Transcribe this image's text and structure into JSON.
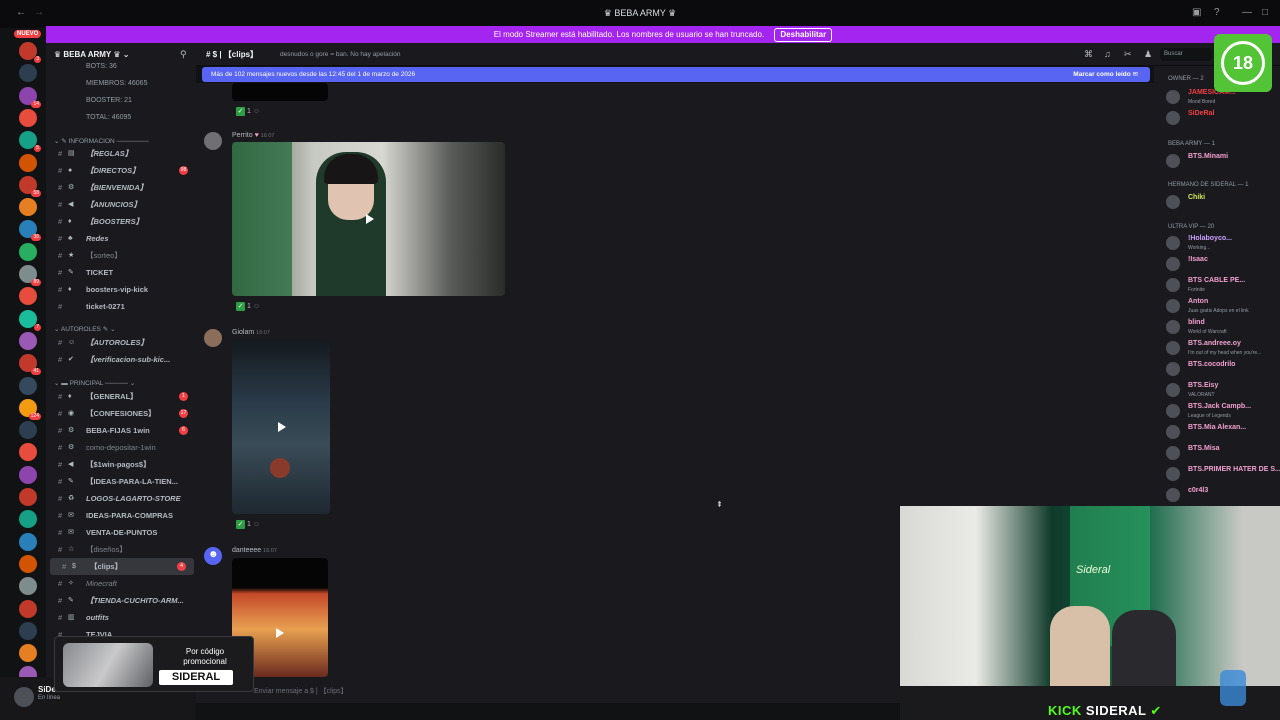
{
  "window": {
    "title": "BEBA ARMY"
  },
  "banner": {
    "text": "El modo Streamer está habilitado. Los nombres de usuario se han truncado.",
    "button": "Deshabilitar"
  },
  "servers": {
    "nuevo_label": "NUEVO",
    "badges": [
      "3",
      "9",
      "14",
      "417",
      "5",
      "260",
      "58",
      "1",
      "36",
      "3",
      "89",
      "10",
      "7",
      "147",
      "41",
      "21",
      "124"
    ]
  },
  "guild": {
    "name": "BEBA ARMY"
  },
  "stats": {
    "bots": "BOTS: 36",
    "members": "MIEMBROS: 46065",
    "boosters": "BOOSTER: 21",
    "total": "TOTAL: 46095"
  },
  "categories": {
    "info": "INFORMACION",
    "autoroles": "AUTOROLES",
    "principal": "PRINCIPAL"
  },
  "channels": [
    {
      "name": "【REGLAS】",
      "emoji": "▤",
      "style": "it"
    },
    {
      "name": "【DIRECTOS】",
      "emoji": "●",
      "style": "it",
      "badge": "98"
    },
    {
      "name": "【BIENVENIDA】",
      "emoji": "⚙",
      "style": "it"
    },
    {
      "name": "【ANUNCIOS】",
      "emoji": "◀",
      "style": "it"
    },
    {
      "name": "【BOOSTERS】",
      "emoji": "♦",
      "style": "it"
    },
    {
      "name": "Redes",
      "emoji": "♣",
      "style": "it"
    },
    {
      "name": "【sorteo】",
      "emoji": "★",
      "style": "dim"
    },
    {
      "name": "TICKET",
      "emoji": "✎",
      "style": ""
    },
    {
      "name": "boosters-vip-kick",
      "emoji": "♦",
      "style": ""
    },
    {
      "name": "ticket-0271",
      "emoji": "",
      "style": ""
    },
    {
      "name": "【AUTOROLES】",
      "emoji": "☺",
      "style": "it"
    },
    {
      "name": "【verificacion-sub-kic...",
      "emoji": "✔",
      "style": "it"
    },
    {
      "name": "【GENERAL】",
      "emoji": "♦",
      "style": "",
      "badge": "1"
    },
    {
      "name": "【CONFESIONES】",
      "emoji": "◉",
      "style": "",
      "badge": "17"
    },
    {
      "name": "BEBA-FIJAS 1win",
      "emoji": "⚙",
      "style": "",
      "badge": "6"
    },
    {
      "name": "como-depositar-1win",
      "emoji": "⚙",
      "style": "dim"
    },
    {
      "name": "【$1win-pagos$】",
      "emoji": "◀",
      "style": ""
    },
    {
      "name": "【IDEAS-PARA-LA-TIEN...",
      "emoji": "✎",
      "style": ""
    },
    {
      "name": "LOGOS-LAGARTO-STORE",
      "emoji": "♻",
      "style": "it"
    },
    {
      "name": "IDEAS-PARA-COMPRAS",
      "emoji": "✉",
      "style": ""
    },
    {
      "name": "VENTA-DE-PUNTOS",
      "emoji": "✉",
      "style": ""
    },
    {
      "name": "【diseños】",
      "emoji": "☆",
      "style": "dim"
    },
    {
      "name": "【clips】",
      "emoji": "$",
      "style": "",
      "badge": "4"
    },
    {
      "name": "Minecraft",
      "emoji": "✧",
      "style": "dim it"
    },
    {
      "name": "【TIENDA-CUCHITO-ARM...",
      "emoji": "✎",
      "style": "it"
    },
    {
      "name": "outfits",
      "emoji": "▥",
      "style": "it"
    },
    {
      "name": "TEJVIA",
      "emoji": "",
      "style": ""
    }
  ],
  "header": {
    "channel": "$ | 【clips】",
    "topic": "desnudos o gore = ban. No hay apelación",
    "search": "Buscar"
  },
  "newbar": {
    "text": "Más de 102 mensajes nuevos desde las 12:45 del 1 de marzo de 2026",
    "mark": "Marcar como leído"
  },
  "messages": [
    {
      "user": "Perrito",
      "time": "16:07",
      "count": "1"
    },
    {
      "user": "Giolam",
      "time": "16:07",
      "count": "1"
    },
    {
      "user": "danteeee",
      "time": "16:07",
      "count": "1"
    }
  ],
  "first_reaction": {
    "count": "1"
  },
  "composer": {
    "placeholder": "Enviar mensaje a $ | 【clips】"
  },
  "members": {
    "groups": {
      "owner": "OWNER — 2",
      "beba": "BEBA ARMY — 1",
      "hermano": "hermano de sideral — 1",
      "ultra": "ULTRA VIP — 20"
    },
    "list": [
      {
        "name": "JAMESICAM...",
        "status": "Mood Bored",
        "color": "#f23f43"
      },
      {
        "name": "SiDeRal",
        "status": "",
        "color": "#f23f43"
      },
      {
        "name": "BTS.Minami",
        "status": "",
        "color": "#f2a0d0"
      },
      {
        "name": "Chiki",
        "status": "",
        "color": "#d4e85b"
      },
      {
        "name": "!Holaboyco...",
        "status": "Working...",
        "color": "#c9a0ff"
      },
      {
        "name": "!Isaac",
        "status": "",
        "color": "#f2a0d0"
      },
      {
        "name": "BTS CABLE PE...",
        "status": "Fortnite",
        "color": "#f2a0d0"
      },
      {
        "name": "Anton",
        "status": "Juas gratis Adops en el link",
        "color": "#f2a0d0"
      },
      {
        "name": "blind",
        "status": "World of Warcraft",
        "color": "#f2a0d0"
      },
      {
        "name": "BTS.andreee.oy",
        "status": "I'm out of my head when you're...",
        "color": "#f2a0d0"
      },
      {
        "name": "BTS.cocodrilo",
        "status": "",
        "color": "#f2a0d0"
      },
      {
        "name": "BTS.Eisy",
        "status": "VALORANT",
        "color": "#f2a0d0"
      },
      {
        "name": "BTS.Jack Campb...",
        "status": "League of Legends",
        "color": "#f2a0d0"
      },
      {
        "name": "BTS.Mia Alexan...",
        "status": "",
        "color": "#f2a0d0"
      },
      {
        "name": "BTS.Misa",
        "status": "",
        "color": "#f2a0d0"
      },
      {
        "name": "BTS.PRIMER HATER DE S...",
        "status": "",
        "color": "#f2a0d0"
      },
      {
        "name": "c0r4l3",
        "status": "",
        "color": "#f2a0d0"
      }
    ]
  },
  "age_rating": {
    "label": "18"
  },
  "promo": {
    "text": "Por código promocional",
    "code": "SIDERAL"
  },
  "user": {
    "name": "SiDe",
    "status": "En línea"
  },
  "overlay": {
    "brand_kick": "KICK",
    "brand_name": "SIDERAL"
  },
  "colors": {
    "accent": "#5865f2",
    "banner": "#a424f0",
    "kick_green": "#53fc18",
    "age_green": "#53c436"
  }
}
